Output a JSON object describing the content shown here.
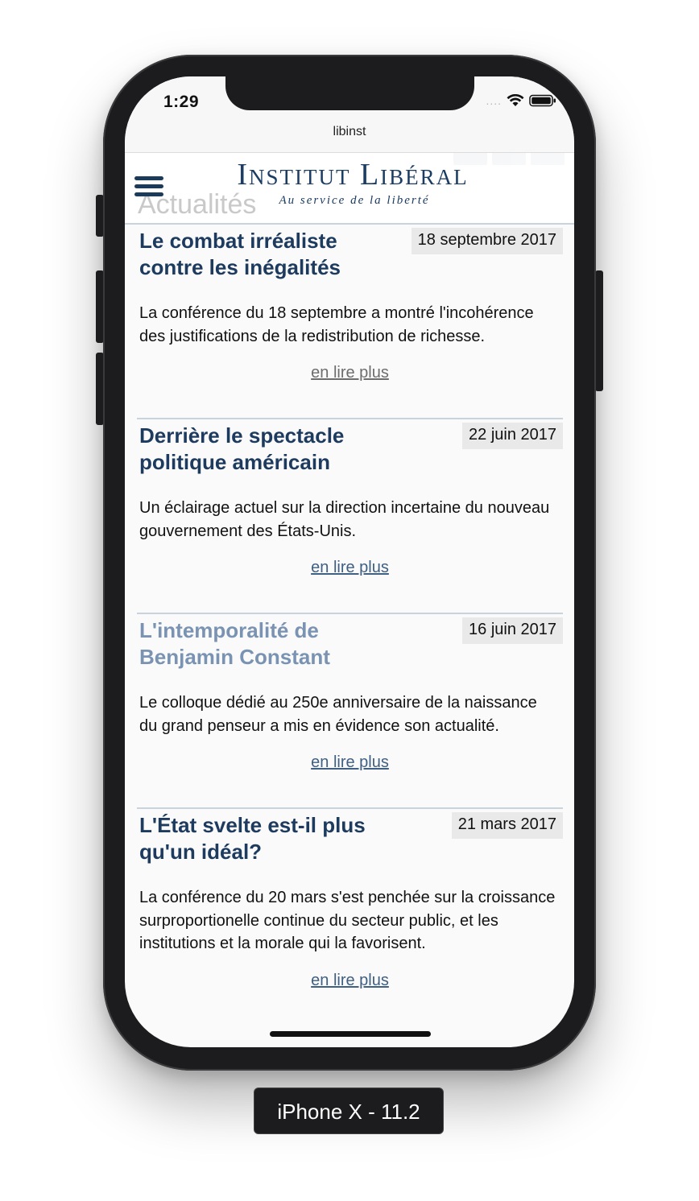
{
  "status_bar": {
    "time": "1:29",
    "signal": "....",
    "icons": [
      "wifi-icon",
      "battery-icon"
    ]
  },
  "browser": {
    "title": "libinst"
  },
  "header": {
    "menu_icon": "hamburger-menu-icon",
    "logo_title": "Institut Libéral",
    "logo_subtitle": "Au service de la liberté",
    "section_heading": "Actualités"
  },
  "articles": [
    {
      "title": "Le combat irréaliste contre les inégalités",
      "date": "18 septembre 2017",
      "summary": "La conférence du 18 septembre a montré l'incohérence des justifications de la redistribution de richesse.",
      "more": "en lire plus",
      "visited": false
    },
    {
      "title": "Derrière le spectacle politique américain",
      "date": "22 juin 2017",
      "summary": "Un éclairage actuel sur la direction incertaine du nouveau gouvernement des États-Unis.",
      "more": "en lire plus",
      "visited": false
    },
    {
      "title": "L'intemporalité de Benjamin Constant",
      "date": "16 juin 2017",
      "summary": "Le colloque dédié au 250e anniversaire de la naissance du grand penseur a mis en évidence son actualité.",
      "more": "en lire plus",
      "visited": true
    },
    {
      "title": "L'État svelte est-il plus qu'un idéal?",
      "date": "21 mars 2017",
      "summary": "La conférence du 20 mars s'est penchée sur la croissance surproportionelle continue du secteur public, et les institutions et la morale qui la favorisent.",
      "more": "en lire plus",
      "visited": false
    }
  ],
  "device_label": "iPhone X - 11.2",
  "colors": {
    "brand": "#1b3c63",
    "title": "#1d3a5f",
    "visited_title": "#7a93b2",
    "link": "#3f5f83",
    "date_bg": "#e9e9e9"
  }
}
